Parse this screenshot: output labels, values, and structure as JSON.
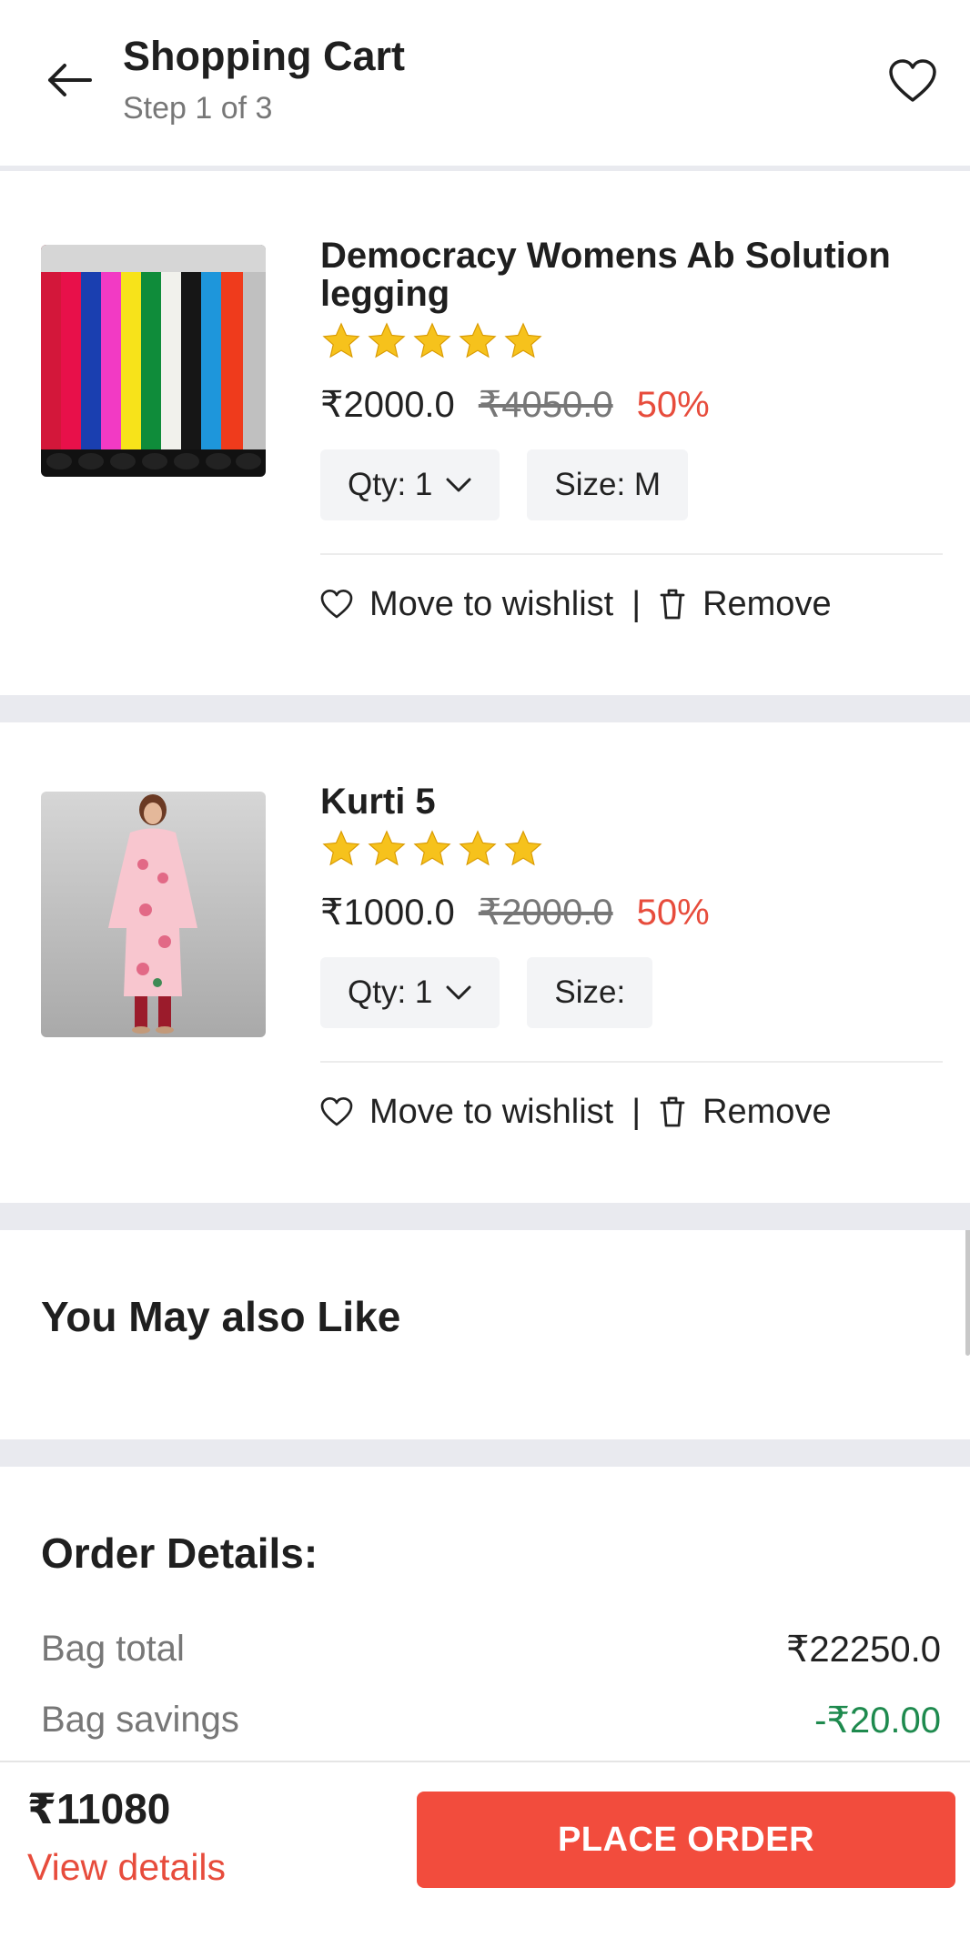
{
  "header": {
    "title": "Shopping Cart",
    "step": "Step 1 of 3",
    "back_icon": "arrow-left-icon",
    "wishlist_icon": "heart-icon"
  },
  "cart": {
    "items": [
      {
        "name": "Democracy Womens Ab Solution legging",
        "rating": 5,
        "price": "₹2000.0",
        "original_price": "₹4050.0",
        "discount": "50%",
        "qty_label": "Qty: 1",
        "size_label": "Size: M",
        "move_to_wishlist": "Move to wishlist",
        "separator": "|",
        "remove": "Remove"
      },
      {
        "name": "Kurti 5",
        "rating": 5,
        "price": "₹1000.0",
        "original_price": "₹2000.0",
        "discount": "50%",
        "qty_label": "Qty: 1",
        "size_label": "Size:",
        "move_to_wishlist": "Move to wishlist",
        "separator": "|",
        "remove": "Remove"
      }
    ]
  },
  "recommendations": {
    "title": "You May also Like"
  },
  "order_details": {
    "title": "Order Details:",
    "rows": [
      {
        "label": "Bag total",
        "value": "₹22250.0"
      },
      {
        "label": "Bag savings",
        "value": "-₹20.00"
      }
    ]
  },
  "footer": {
    "total": "₹11080",
    "view_details": "View details",
    "place_order": "PLACE ORDER"
  },
  "colors": {
    "accent": "#f24c3d",
    "discount": "#e74c3c",
    "savings": "#1e8a4e",
    "star": "#f6c21c",
    "separator": "#e9eaef"
  }
}
